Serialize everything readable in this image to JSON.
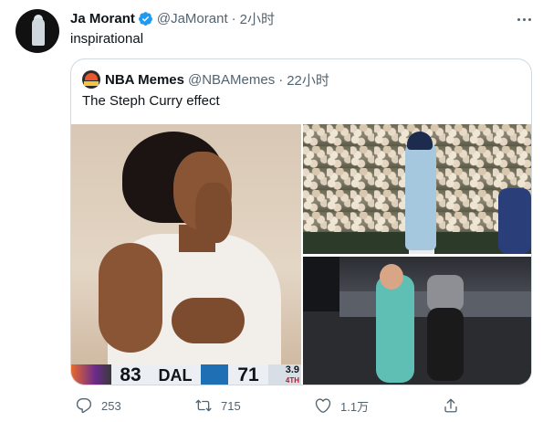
{
  "author": {
    "name": "Ja Morant",
    "handle": "@JaMorant",
    "separator": "·",
    "time": "2小时"
  },
  "tweet": {
    "text": "inspirational"
  },
  "quoted": {
    "name": "NBA Memes",
    "handle": "@NBAMemes",
    "separator": "·",
    "time": "22小时",
    "text": "The Steph Curry effect",
    "scorebug": {
      "home_score": "83",
      "away_team": "DAL",
      "away_score": "71",
      "clock_top": "3.9",
      "clock_bottom": "4TH"
    }
  },
  "actions": {
    "replies": "253",
    "retweets": "715",
    "likes": "1.1万"
  },
  "colors": {
    "text_primary": "#0f1419",
    "text_secondary": "#536471",
    "verified": "#1d9bf0",
    "border": "#cfd9de"
  },
  "icons": [
    "verified-badge-icon",
    "more-options-icon",
    "reply-icon",
    "retweet-icon",
    "like-icon",
    "share-icon"
  ]
}
